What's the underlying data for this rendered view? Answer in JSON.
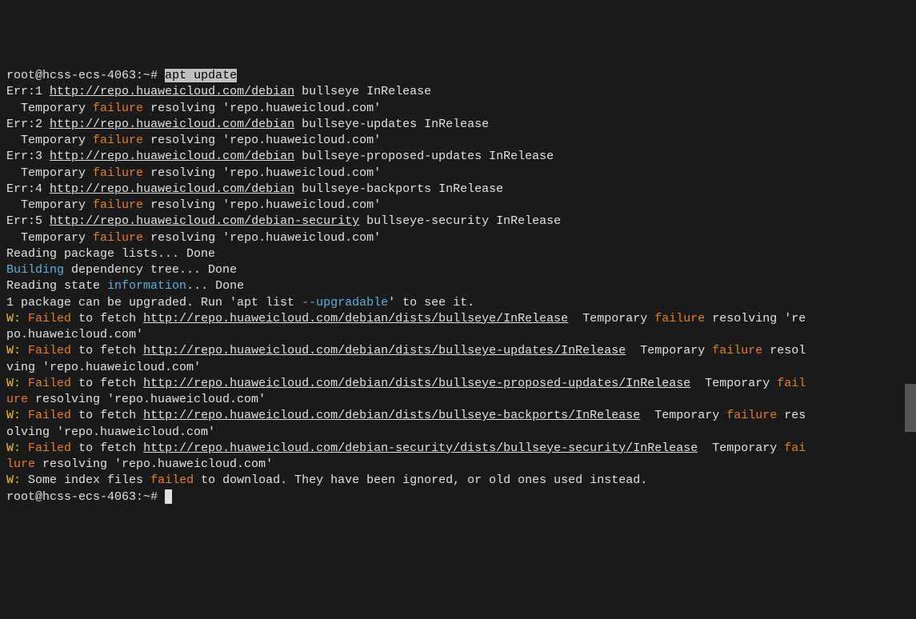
{
  "prompt": {
    "user_host": "root@hcss-ecs-4063",
    "path": "~",
    "symbol": "#",
    "command": "apt update"
  },
  "repo_url": "http://repo.huaweicloud.com/debian",
  "repo_security_url": "http://repo.huaweicloud.com/debian-security",
  "repo_host": "repo.huaweicloud.com",
  "errors": [
    {
      "n": "1",
      "suite": "bullseye InRelease"
    },
    {
      "n": "2",
      "suite": "bullseye-updates InRelease"
    },
    {
      "n": "3",
      "suite": "bullseye-proposed-updates InRelease"
    },
    {
      "n": "4",
      "suite": "bullseye-backports InRelease"
    },
    {
      "n": "5",
      "suite": "bullseye-security InRelease",
      "security": true
    }
  ],
  "temp_failure_pre": "Temporary",
  "failure_word": "failure",
  "resolving_text": "resolving",
  "reading_pkg": "Reading package lists... Done",
  "building": "Building",
  "dep_tree": "dependency tree... Done",
  "reading_state": "Reading state",
  "information": "information",
  "done_tail": "... Done",
  "upgrade_line_pre": "1 package can be upgraded. Run 'apt list",
  "upgrade_flag": "--upgradable",
  "upgrade_line_post": "' to see it.",
  "W": "W:",
  "failed": "Failed",
  "to_fetch": "to fetch",
  "temporary": "Temporary",
  "warn_urls": [
    "http://repo.huaweicloud.com/debian/dists/bullseye/InRelease",
    "http://repo.huaweicloud.com/debian/dists/bullseye-updates/InRelease",
    "http://repo.huaweicloud.com/debian/dists/bullseye-proposed-updates/InRelease",
    "http://repo.huaweicloud.com/debian/dists/bullseye-backports/InRelease",
    "http://repo.huaweicloud.com/debian-security/dists/bullseye-security/InRelease"
  ],
  "warn_tails": [
    {
      "a": "  Temporary ",
      "f": "failure",
      "b": " resolving 're",
      "c": "po.huaweicloud.com'"
    },
    {
      "a": "  Temporary ",
      "f": "failure",
      "b": " resol",
      "c": "ving 'repo.huaweicloud.com'"
    },
    {
      "a": "  Temporary ",
      "f": "fail",
      "b": "",
      "c": "ure resolving 'repo.huaweicloud.com'",
      "fc": "ure"
    },
    {
      "a": "  Temporary ",
      "f": "failure",
      "b": " res",
      "c": "olving 'repo.huaweicloud.com'"
    },
    {
      "a": "  Temporary ",
      "f": "fai",
      "b": "",
      "c": "lure resolving 'repo.huaweicloud.com'",
      "fc": "lure"
    }
  ],
  "final_warn_pre": "Some index files",
  "final_warn_failed": "failed",
  "final_warn_post": "to download. They have been ignored, or old ones used instead.",
  "prompt2": {
    "user_host": "root@hcss-ecs-4063",
    "path": "~",
    "symbol": "#"
  }
}
